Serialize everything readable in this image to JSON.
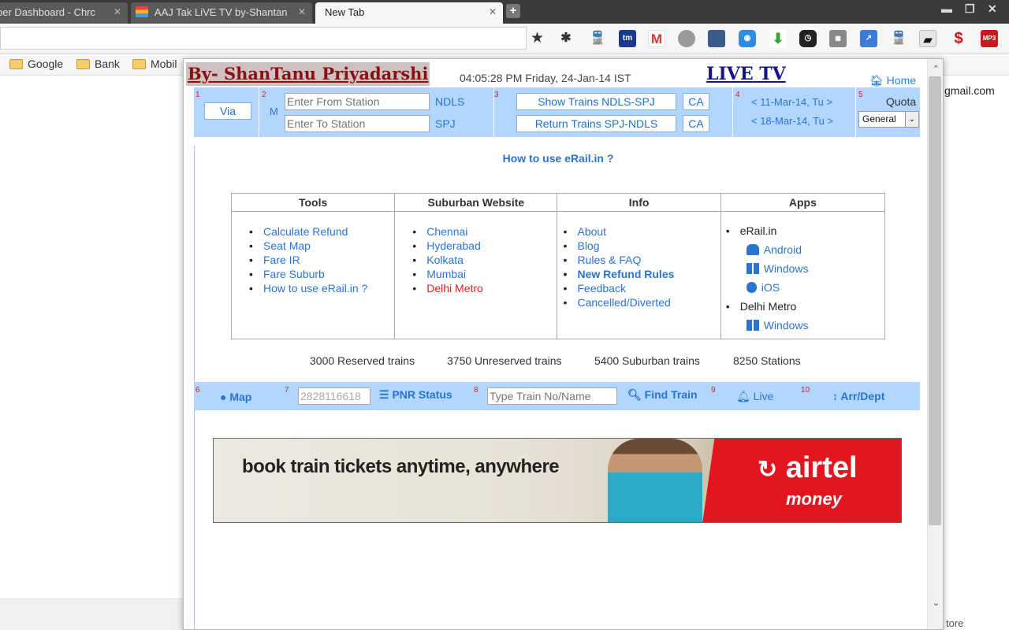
{
  "browser": {
    "tabs": [
      {
        "title": "per Dashboard - Chrc"
      },
      {
        "title": "AAJ Tak LiVE TV by-Shantan"
      },
      {
        "title": "New Tab"
      }
    ],
    "bookmarks": [
      "Google",
      "Bank",
      "Mobil"
    ],
    "background_page": {
      "email_fragment": "gmail.com",
      "store_fragment": "tore"
    }
  },
  "popup": {
    "title": "By- ShanTanu Priyadarshi",
    "datetime": "04:05:28 PM Friday, 24-Jan-14 IST",
    "live_tv": "LIVE TV",
    "home": "Home",
    "search": {
      "num1": "1",
      "num2": "2",
      "num3": "3",
      "num4": "4",
      "num5": "5",
      "via_button": "Via",
      "m_label": "M",
      "from_placeholder": "Enter From Station",
      "to_placeholder": "Enter To Station",
      "from_code": "NDLS",
      "to_code": "SPJ",
      "show_trains": "Show Trains  NDLS-SPJ",
      "return_trains": "Return Trains  SPJ-NDLS",
      "ca1": "CA",
      "ca2": "CA",
      "date1": "< 11-Mar-14, Tu >",
      "date2": "< 18-Mar-14, Tu >",
      "quota_label": "Quota",
      "quota_value": "General"
    },
    "howto": "How to use eRail.in ?",
    "table": {
      "headers": [
        "Tools",
        "Suburban Website",
        "Info",
        "Apps"
      ],
      "tools": [
        "Calculate Refund",
        "Seat Map",
        "Fare IR",
        "Fare Suburb",
        "How to use eRail.in ?"
      ],
      "suburban": [
        "Chennai",
        "Hyderabad",
        "Kolkata",
        "Mumbai",
        "Delhi Metro"
      ],
      "info": [
        "About",
        "Blog",
        "Rules & FAQ",
        "New Refund Rules",
        "Feedback",
        "Cancelled/Diverted"
      ],
      "apps": {
        "erail": "eRail.in",
        "android": "Android",
        "windows": "Windows",
        "ios": "iOS",
        "delhi_metro": "Delhi Metro",
        "metro_windows": "Windows"
      }
    },
    "stats": [
      "3000 Reserved trains",
      "3750 Unreserved trains",
      "5400 Suburban trains",
      "8250 Stations"
    ],
    "bottom": {
      "num6": "6",
      "num7": "7",
      "num8": "8",
      "num9": "9",
      "num10": "10",
      "map": "Map",
      "pnr_value": "2828116618",
      "pnr_status": "PNR Status",
      "train_placeholder": "Type Train No/Name",
      "find_train": "Find Train",
      "live": "Live",
      "arr_dept": "Arr/Dept"
    },
    "ad": {
      "text": "book train tickets anytime, anywhere",
      "brand": "airtel",
      "sub": "money"
    }
  },
  "colors": {
    "accent_blue": "#2a74d0",
    "bar_blue": "#b3d6ff",
    "title_red": "#8b0f0f",
    "live_blue": "#151585"
  }
}
